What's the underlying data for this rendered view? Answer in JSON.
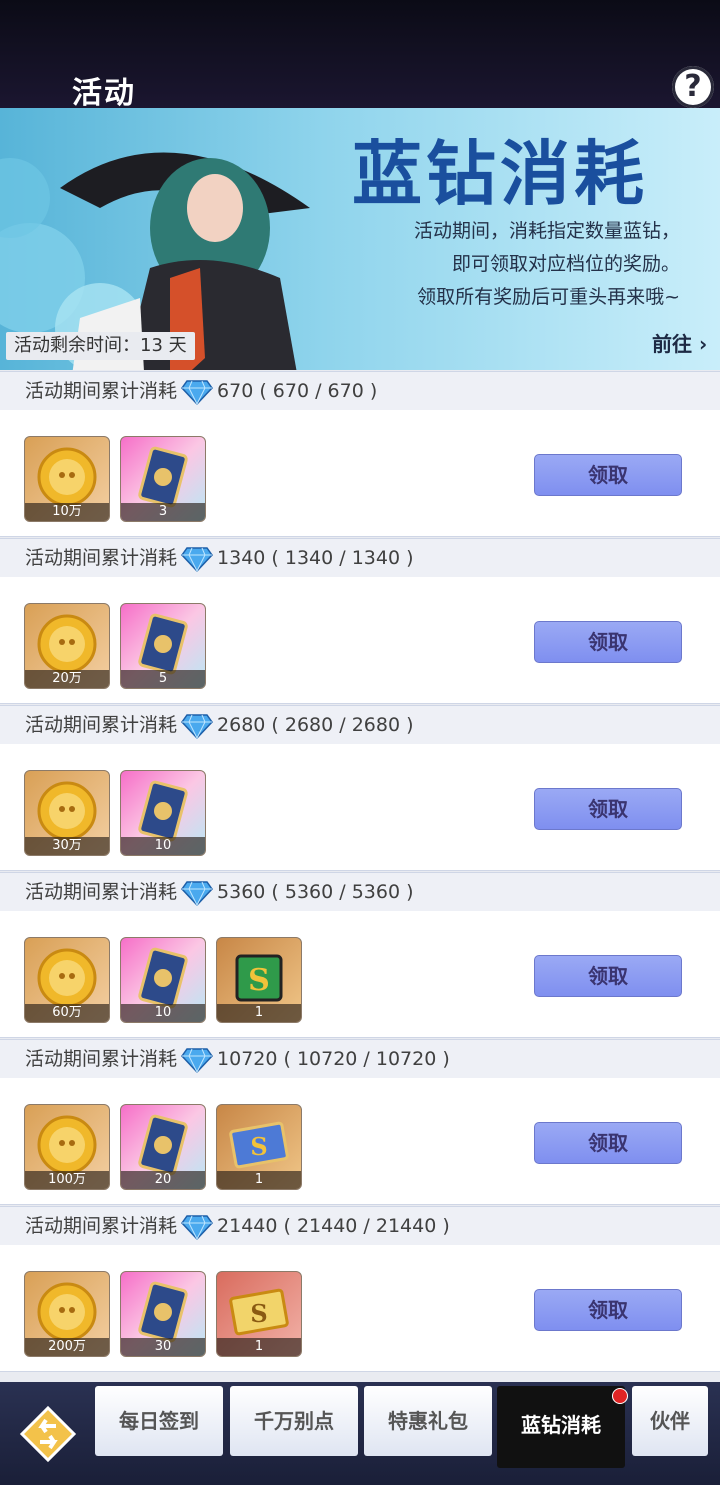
{
  "header": {
    "title": "活动",
    "help_icon": "?"
  },
  "banner": {
    "heading": "蓝钻消耗",
    "lines": [
      "活动期间，消耗指定数量蓝钻，",
      "即可领取对应档位的奖励。",
      "领取所有奖励后可重头再来哦~"
    ],
    "remaining": "活动剩余时间：13 天",
    "goto": "前往 ›"
  },
  "sections": [
    {
      "label": "活动期间累计消耗",
      "amount": "670 ( 670 / 670 )",
      "items": [
        {
          "type": "gold-coin",
          "count": "10万"
        },
        {
          "type": "card",
          "count": "3"
        }
      ],
      "button": "领取"
    },
    {
      "label": "活动期间累计消耗",
      "amount": "1340 ( 1340 / 1340 )",
      "items": [
        {
          "type": "gold-coin",
          "count": "20万"
        },
        {
          "type": "card",
          "count": "5"
        }
      ],
      "button": "领取"
    },
    {
      "label": "活动期间累计消耗",
      "amount": "2680 ( 2680 / 2680 )",
      "items": [
        {
          "type": "gold-coin",
          "count": "30万"
        },
        {
          "type": "card",
          "count": "10"
        }
      ],
      "button": "领取"
    },
    {
      "label": "活动期间累计消耗",
      "amount": "5360 ( 5360 / 5360 )",
      "items": [
        {
          "type": "gold-coin",
          "count": "60万"
        },
        {
          "type": "card",
          "count": "10"
        },
        {
          "type": "s-ticket-green",
          "count": "1"
        }
      ],
      "button": "领取"
    },
    {
      "label": "活动期间累计消耗",
      "amount": "10720 ( 10720 / 10720 )",
      "items": [
        {
          "type": "gold-coin",
          "count": "100万"
        },
        {
          "type": "card",
          "count": "20"
        },
        {
          "type": "s-ticket-blue",
          "count": "1"
        }
      ],
      "button": "领取"
    },
    {
      "label": "活动期间累计消耗",
      "amount": "21440 ( 21440 / 21440 )",
      "items": [
        {
          "type": "gold-coin",
          "count": "200万"
        },
        {
          "type": "card",
          "count": "30"
        },
        {
          "type": "s-ticket-gold",
          "count": "1"
        }
      ],
      "button": "领取"
    }
  ],
  "tabs": [
    "每日签到",
    "千万别点",
    "特惠礼包",
    "蓝钻消耗",
    "伙伴"
  ],
  "active_tab": "蓝钻消耗",
  "colors": {
    "button": "#8b9af2",
    "accent": "#1a4f9e",
    "badge": "#e02424"
  }
}
